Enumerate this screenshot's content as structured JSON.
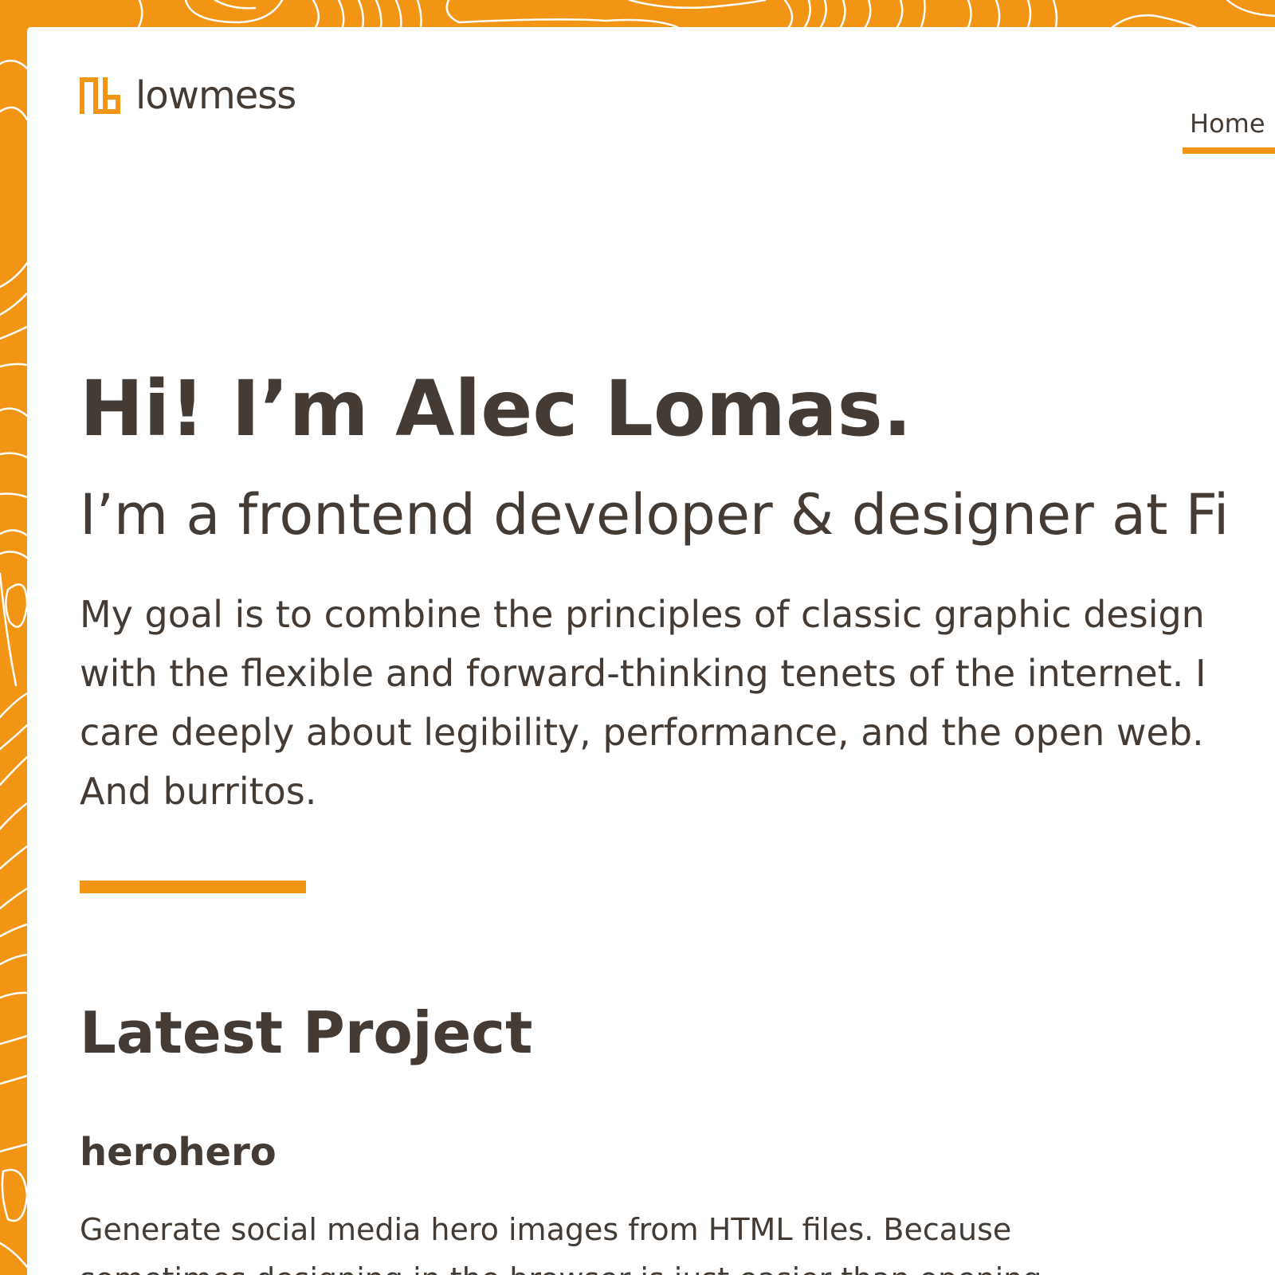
{
  "brand": {
    "name": "lowmess",
    "accent_color": "#F29414",
    "text_color": "#433B34",
    "logo_icon": "lowmess-logo-icon"
  },
  "nav": {
    "items": [
      {
        "label": "Home",
        "active": true
      }
    ]
  },
  "hero": {
    "title": "Hi! I’m Alec Lomas.",
    "subtitle": "I’m a frontend developer & designer at Fi",
    "lines": [
      "My goal is to combine the principles of classic graphic design",
      "with the flexible and forward-thinking tenets of the internet. I",
      "care deeply about legibility, performance, and the open web.",
      "And burritos."
    ]
  },
  "latest": {
    "heading": "Latest Project",
    "project": {
      "name": "herohero",
      "lines": [
        "Generate social media hero images from HTML files. Because",
        "sometimes designing in the browser is just easier than opening"
      ]
    }
  }
}
